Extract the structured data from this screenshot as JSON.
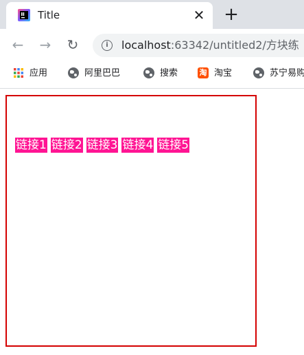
{
  "tab": {
    "title": "Title",
    "close_glyph": "✕",
    "new_tab_glyph": "+"
  },
  "toolbar": {
    "back_glyph": "←",
    "forward_glyph": "→",
    "reload_glyph": "↻",
    "info_glyph": "i",
    "url_host": "localhost",
    "url_path": ":63342/untitled2/方块练"
  },
  "bookmarks": [
    {
      "label": "应用",
      "icon": "apps-grid-icon"
    },
    {
      "label": "阿里巴巴",
      "icon": "globe-icon"
    },
    {
      "label": "搜索",
      "icon": "globe-icon"
    },
    {
      "label": "淘宝",
      "icon": "taobao-icon",
      "icon_text": "淘"
    },
    {
      "label": "苏宁易购",
      "icon": "globe-icon"
    }
  ],
  "links": [
    "链接1",
    "链接2",
    "链接3",
    "链接4",
    "链接5"
  ],
  "colors": {
    "link_bg": "#ff1493",
    "box_border": "#d40000",
    "tabstrip": "#dee1e6"
  }
}
